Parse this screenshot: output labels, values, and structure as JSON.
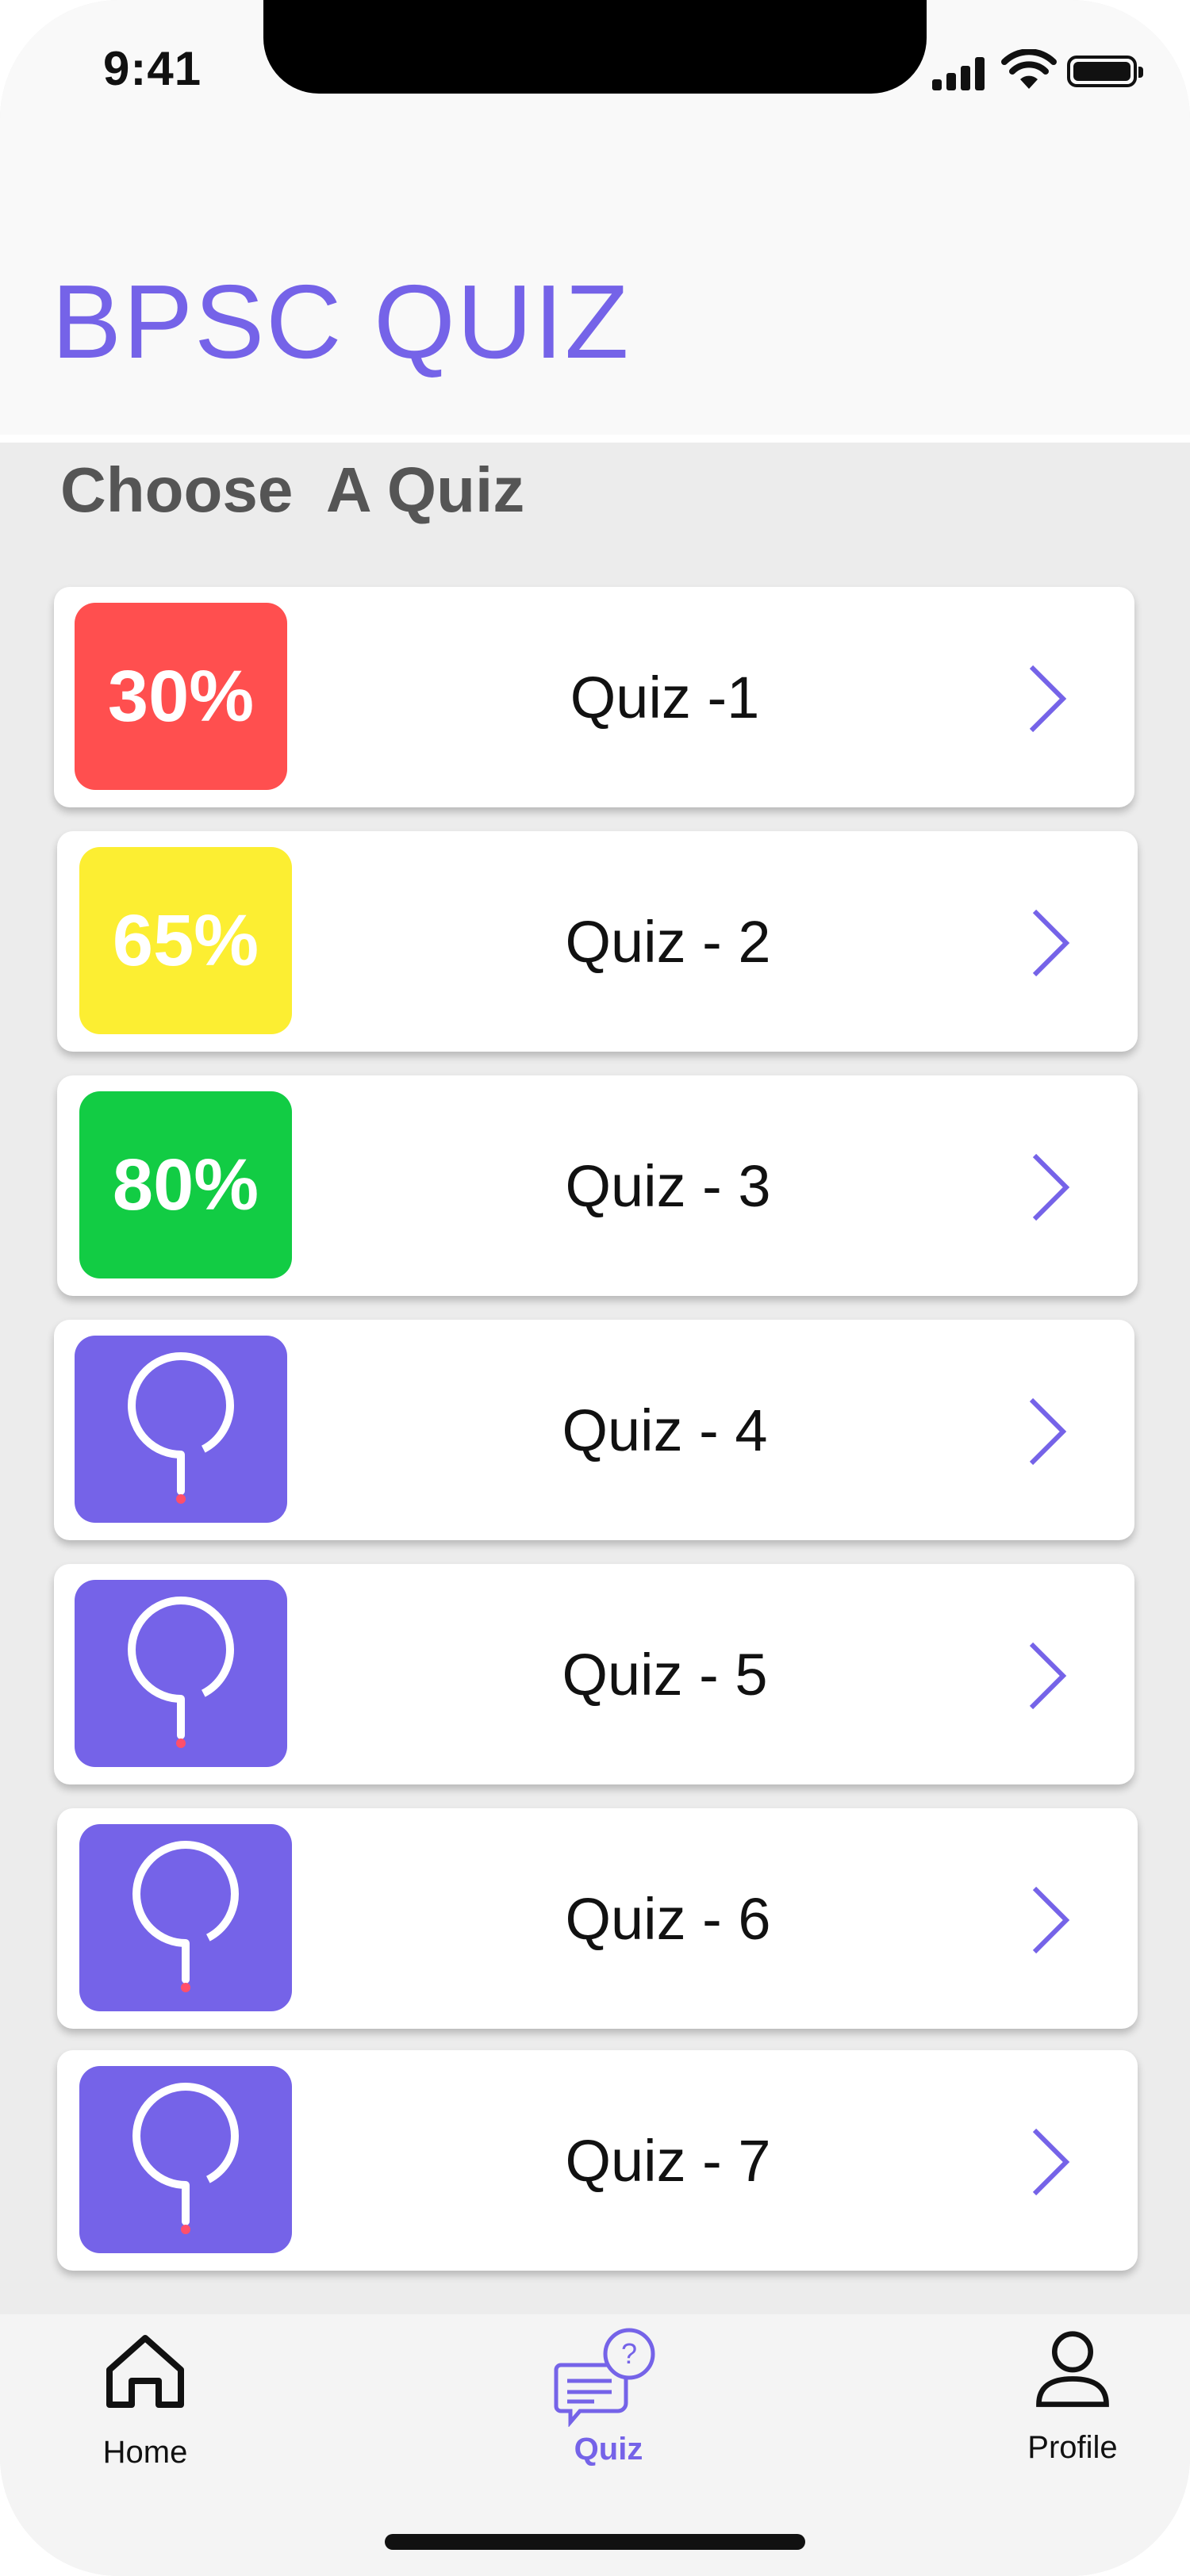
{
  "status_bar": {
    "time": "9:41"
  },
  "header": {
    "title": "BPSC QUIZ",
    "subtitle": "Choose  A Quiz"
  },
  "colors": {
    "accent": "#7563e8",
    "badge_low": "#ff4f4f",
    "badge_mid": "#fcee32",
    "badge_high": "#12cc44",
    "badge_new": "#7563e8"
  },
  "quizzes": [
    {
      "label": "Quiz -1",
      "badge_text": "30%",
      "badge_color": "#ff4f4f",
      "icon": "chevron-right-icon"
    },
    {
      "label": "Quiz - 2",
      "badge_text": "65%",
      "badge_color": "#fcee32",
      "icon": "chevron-right-icon"
    },
    {
      "label": "Quiz - 3",
      "badge_text": "80%",
      "badge_color": "#12cc44",
      "icon": "chevron-right-icon"
    },
    {
      "label": "Quiz - 4",
      "badge_text": "",
      "badge_icon": "question-icon",
      "badge_color": "#7563e8"
    },
    {
      "label": "Quiz - 5",
      "badge_text": "",
      "badge_icon": "question-icon",
      "badge_color": "#7563e8"
    },
    {
      "label": "Quiz - 6",
      "badge_text": "",
      "badge_icon": "question-icon",
      "badge_color": "#7563e8"
    },
    {
      "label": "Quiz - 7",
      "badge_text": "",
      "badge_icon": "question-icon",
      "badge_color": "#7563e8"
    }
  ],
  "tabbar": {
    "items": [
      {
        "label": "Home",
        "icon": "home-icon"
      },
      {
        "label": "Quiz",
        "icon": "quiz-chat-icon",
        "active": true
      },
      {
        "label": "Profile",
        "icon": "profile-icon"
      }
    ]
  }
}
